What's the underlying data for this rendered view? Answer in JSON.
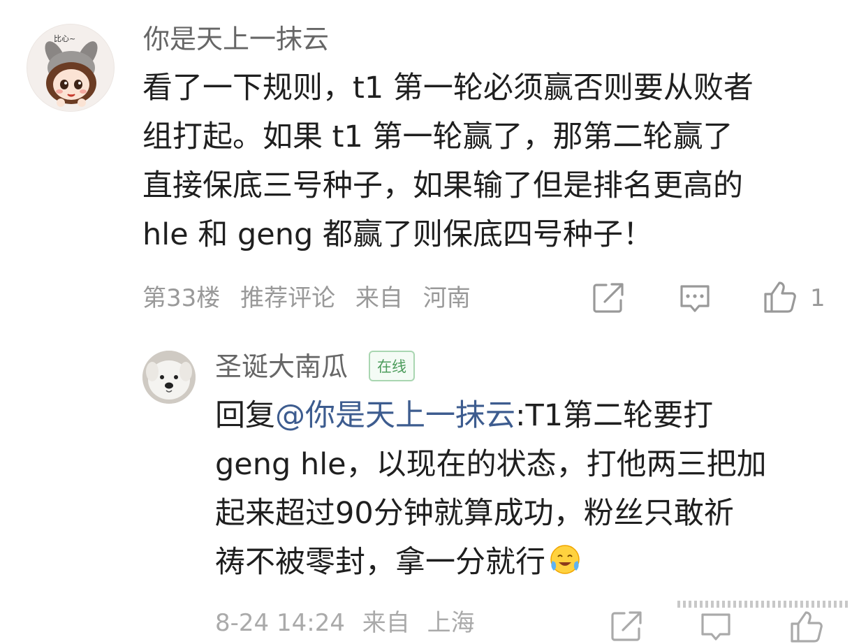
{
  "comment": {
    "username": "你是天上一抹云",
    "avatar_badge": "比心~",
    "text_lines": [
      "看了一下规则，t1 第一轮必须赢否则要从败者",
      "组打起。如果 t1 第一轮赢了，那第二轮赢了",
      "直接保底三号种子，如果输了但是排名更高的",
      "hle 和 geng 都赢了则保底四号种子！"
    ],
    "floor": "第33楼",
    "tag": "推荐评论",
    "from_label": "来自",
    "location": "河南",
    "like_count": "1",
    "icons": [
      "share-icon",
      "reply-icon",
      "like-icon"
    ]
  },
  "reply": {
    "username": "圣诞大南瓜",
    "online_badge": "在线",
    "prefix": "回复",
    "mention": "@你是天上一抹云",
    "text_lines": [
      ":T1第二轮要打",
      "geng hle，以现在的状态，打他两三把加",
      "起来超过90分钟就算成功，粉丝只敢祈",
      "祷不被零封，拿一分就行"
    ],
    "emoji": "crying-smile-emoji",
    "time": "8-24 14:24",
    "from_label": "来自",
    "location": "上海"
  },
  "colors": {
    "text": "#1f1f1f",
    "secondary": "#999999",
    "mention": "#3d5c8f",
    "online": "#4d9c5c"
  }
}
